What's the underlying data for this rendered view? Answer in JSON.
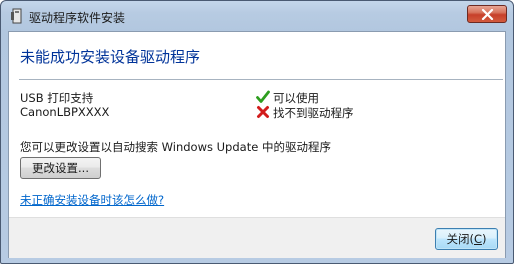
{
  "window": {
    "title": "驱动程序软件安装"
  },
  "dialog": {
    "heading": "未能成功安装设备驱动程序",
    "devices": [
      {
        "name": "USB 打印支持",
        "status": "可以使用",
        "status_icon": "green-check-icon"
      },
      {
        "name": "CanonLBPXXXX",
        "status": "找不到驱动程序",
        "status_icon": "red-x-icon"
      }
    ],
    "info_text": "您可以更改设置以自动搜索 Windows Update 中的驱动程序",
    "change_settings_label": "更改设置...",
    "help_link": "未正确安装设备时该怎么做?",
    "close_label_prefix": "关闭(",
    "close_label_key": "C",
    "close_label_suffix": ")"
  },
  "colors": {
    "heading": "#003399",
    "link": "#0066cc",
    "check": "#2e9e1f",
    "error": "#d21d1d"
  }
}
